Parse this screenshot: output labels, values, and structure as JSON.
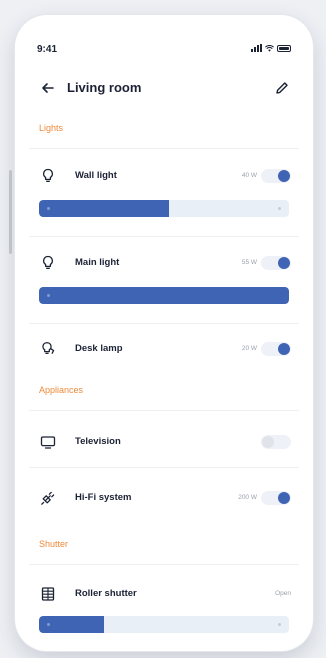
{
  "status_bar": {
    "time": "9:41"
  },
  "header": {
    "title": "Living room",
    "back_icon": "arrow-left-icon",
    "edit_icon": "pencil-icon"
  },
  "sections": {
    "lights": "Lights",
    "appliances": "Appliances",
    "shutter": "Shutter"
  },
  "lights": {
    "wall": {
      "label": "Wall light",
      "power": "40 W",
      "on": true,
      "brightness_pct": 52
    },
    "main": {
      "label": "Main light",
      "power": "55 W",
      "on": true,
      "brightness_pct": 100
    },
    "desk": {
      "label": "Desk lamp",
      "power": "20 W",
      "on": true
    }
  },
  "appliances": {
    "tv": {
      "label": "Television",
      "on": false
    },
    "hifi": {
      "label": "Hi-Fi system",
      "power": "200 W",
      "on": true
    }
  },
  "shutter": {
    "roller": {
      "label": "Roller shutter",
      "state": "Open",
      "open_pct": 26
    }
  },
  "colors": {
    "accent": "#3f64b3",
    "section": "#ee8a3a",
    "text": "#1b2234",
    "track": "#e8eff7"
  }
}
